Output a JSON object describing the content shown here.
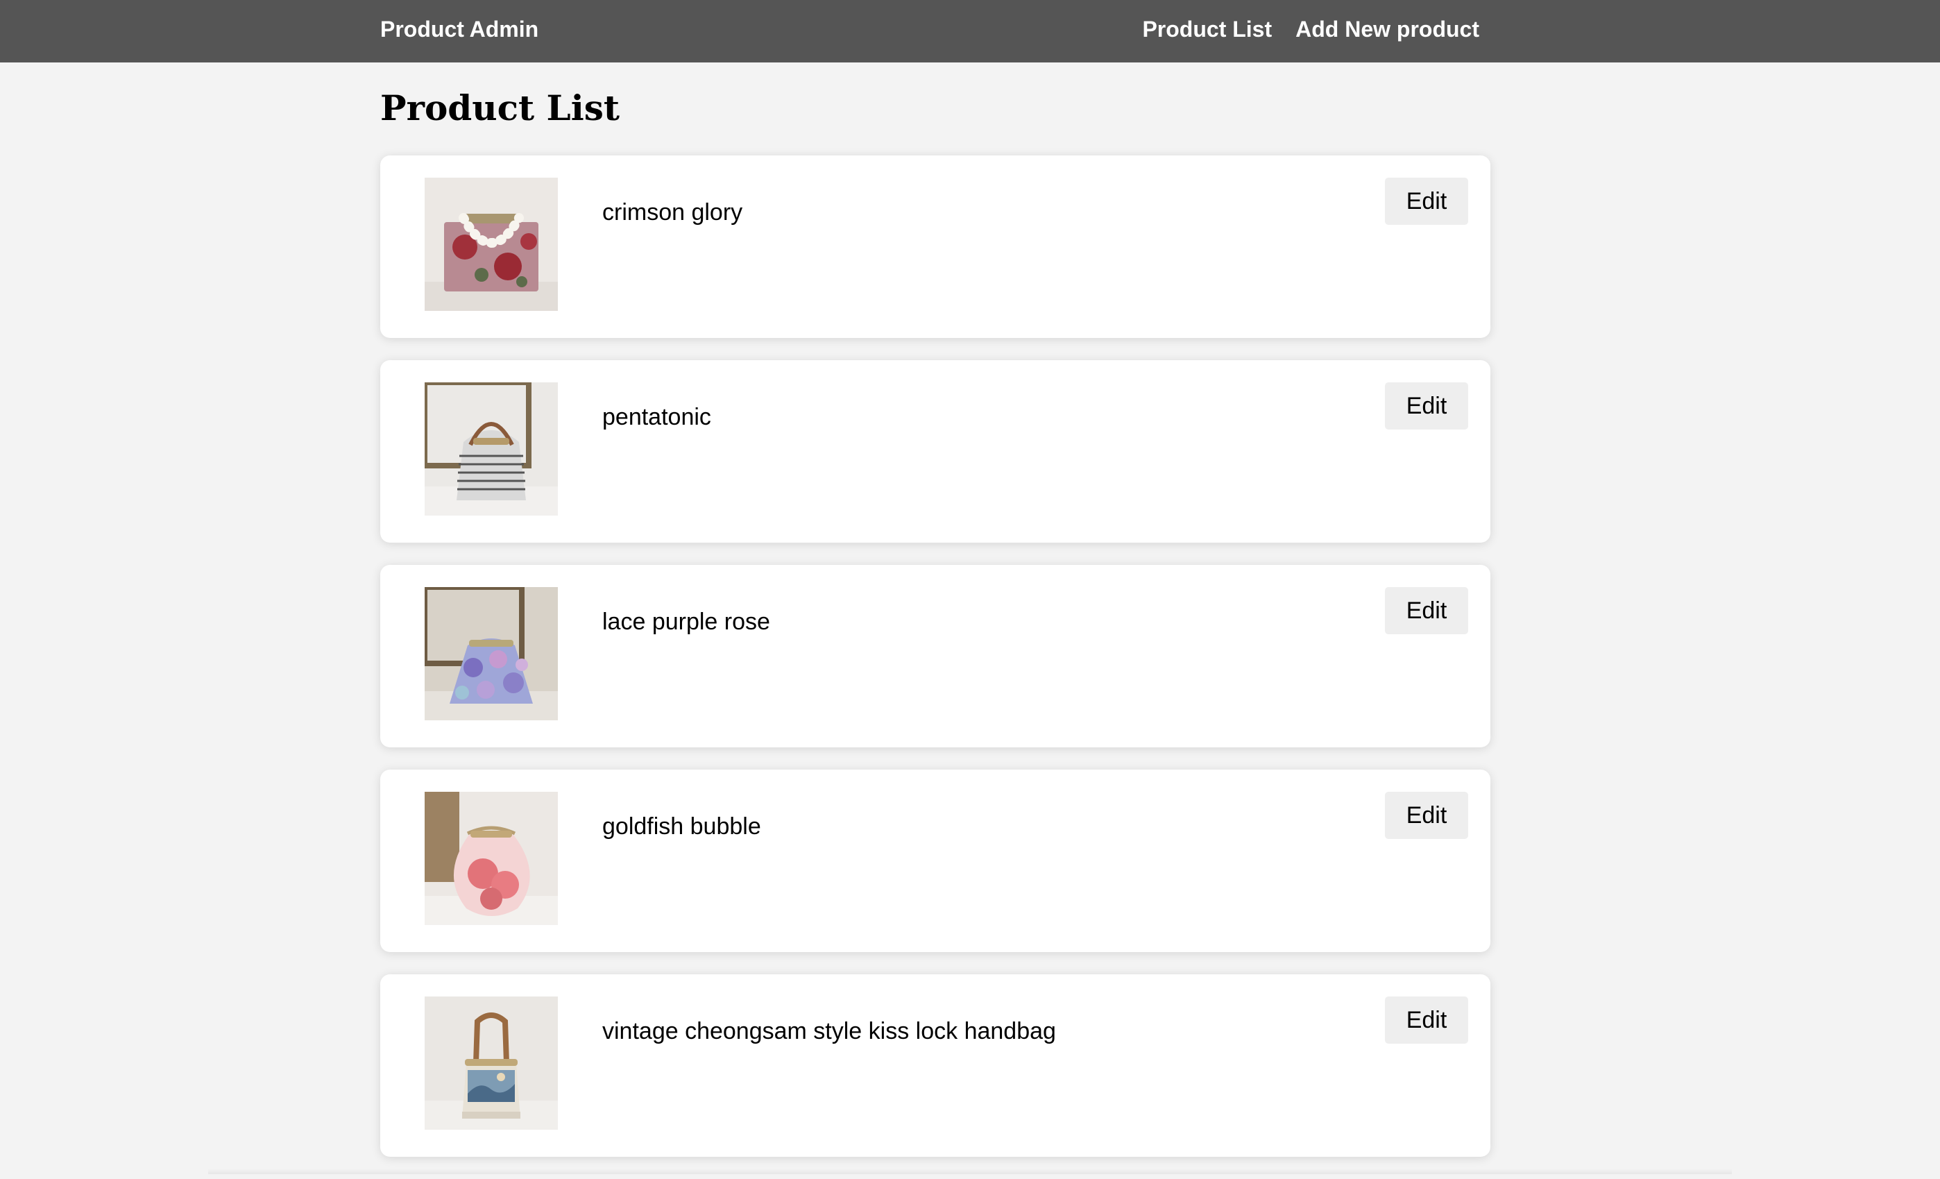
{
  "header": {
    "brand": "Product Admin",
    "nav": [
      {
        "label": "Product List"
      },
      {
        "label": "Add New product"
      }
    ]
  },
  "page": {
    "title": "Product List"
  },
  "products": [
    {
      "name": "crimson glory",
      "edit_label": "Edit"
    },
    {
      "name": "pentatonic",
      "edit_label": "Edit"
    },
    {
      "name": "lace purple rose",
      "edit_label": "Edit"
    },
    {
      "name": "goldfish bubble",
      "edit_label": "Edit"
    },
    {
      "name": "vintage cheongsam style kiss lock handbag",
      "edit_label": "Edit"
    }
  ],
  "colors": {
    "header_bg": "#555555",
    "page_bg": "#f3f3f3",
    "card_bg": "#ffffff",
    "button_bg": "#eeeeee"
  }
}
